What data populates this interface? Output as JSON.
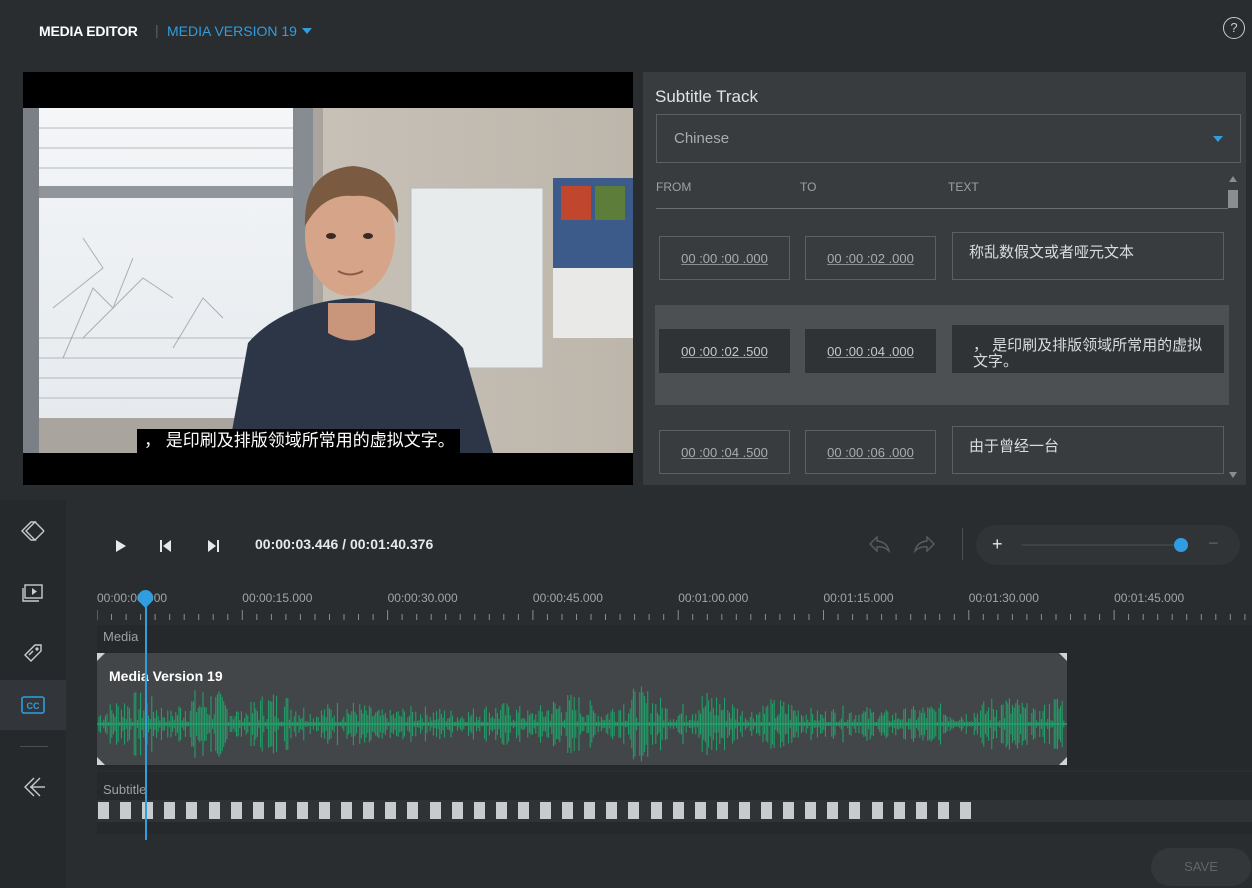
{
  "header": {
    "app_title": "MEDIA EDITOR",
    "separator": "|",
    "version_label": "MEDIA VERSION 19",
    "help_label": "?"
  },
  "video": {
    "caption": "， 是印刷及排版领域所常用的虚拟文字。"
  },
  "subtitle_panel": {
    "title": "Subtitle Track",
    "language": "Chinese",
    "columns": {
      "from": "FROM",
      "to": "TO",
      "text": "TEXT"
    },
    "rows": [
      {
        "from": "00 :00 :00 .000",
        "to": "00 :00 :02 .000",
        "text": "称乱数假文或者哑元文本",
        "active": false
      },
      {
        "from": "00 :00 :02 .500",
        "to": "00 :00 :04 .000",
        "text": "， 是印刷及排版领域所常用的虚拟文字。",
        "active": true
      },
      {
        "from": "00 :00 :04 .500",
        "to": "00 :00 :06 .000",
        "text": "由于曾经一台",
        "active": false
      }
    ]
  },
  "player": {
    "timecode": "00:00:03.446  /  00:01:40.376",
    "zoom_in_label": "+",
    "zoom_out_label": "−",
    "zoom_level": 0.96
  },
  "ruler": {
    "labels": [
      "00:00:00.000",
      "00:00:15.000",
      "00:00:30.000",
      "00:00:45.000",
      "00:01:00.000",
      "00:01:15.000",
      "00:01:30.000",
      "00:01:45.000"
    ]
  },
  "tracks": {
    "media_label": "Media",
    "clip_title": "Media Version 19",
    "subtitle_label": "Subtitle",
    "subtitle_block_count": 40
  },
  "tool_rail": {
    "items": [
      "collapse-icon",
      "media-icon",
      "tag-icon",
      "cc-icon",
      "exit-icon"
    ],
    "cc_label": "CC"
  },
  "save_label": "SAVE",
  "colors": {
    "accent": "#2f9de0",
    "waveform": "#1fa56a",
    "background": "#2a2d2f"
  }
}
